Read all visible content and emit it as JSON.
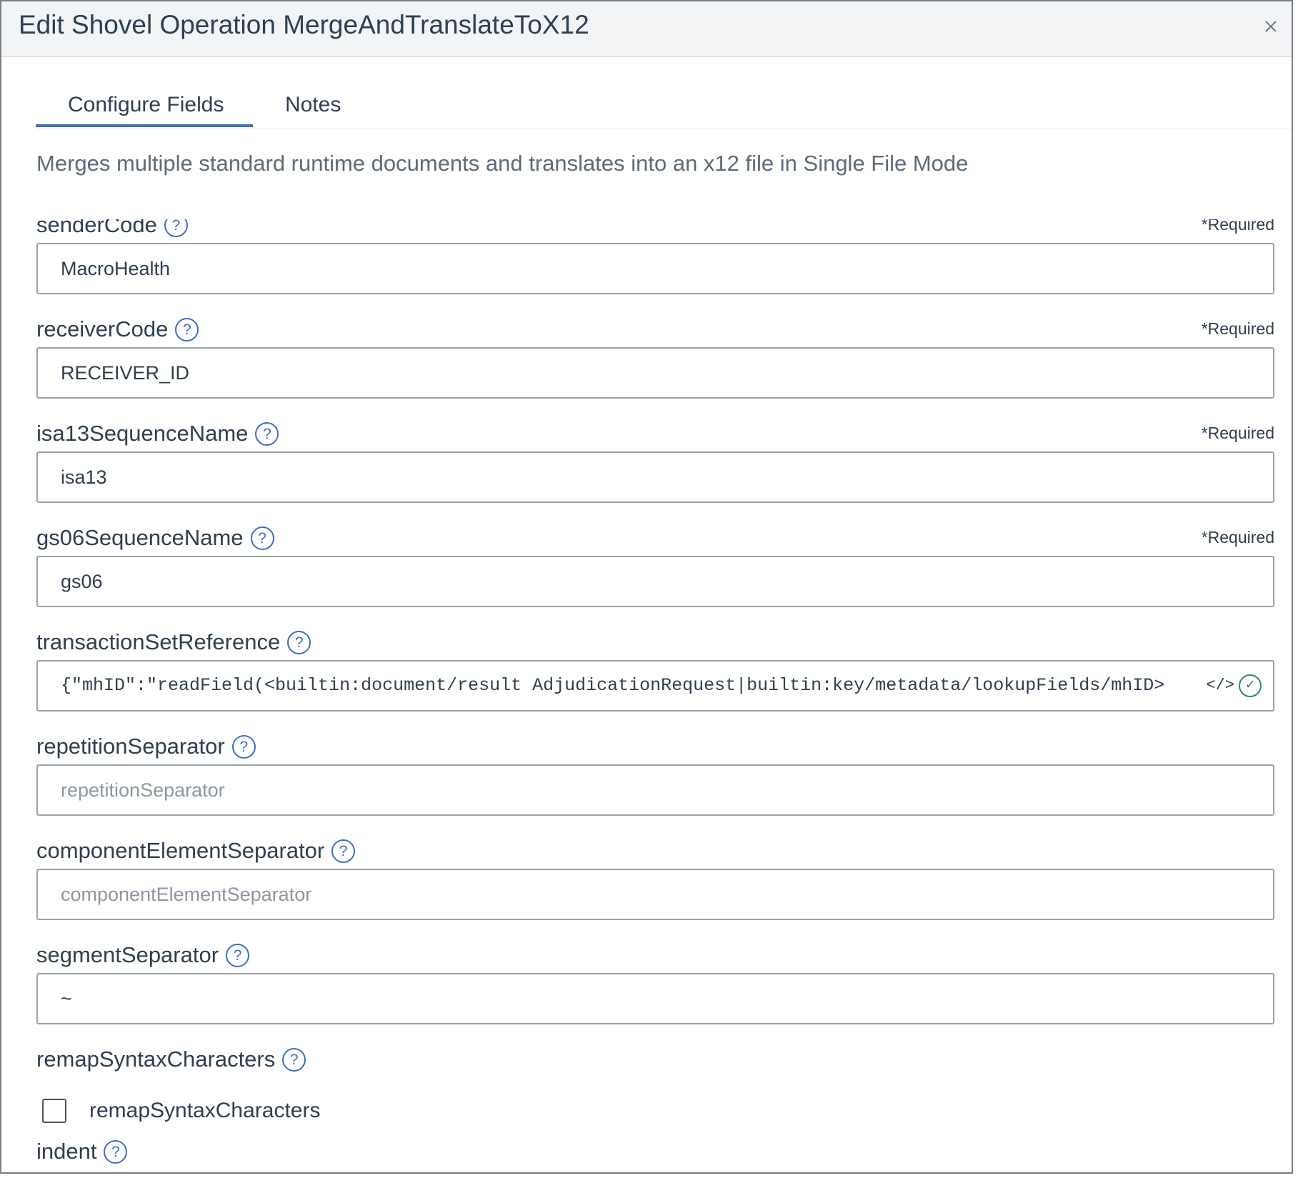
{
  "dialog": {
    "title": "Edit Shovel Operation MergeAndTranslateToX12",
    "close_glyph": "×"
  },
  "tabs": [
    {
      "label": "Configure Fields",
      "active": true
    },
    {
      "label": "Notes",
      "active": false
    }
  ],
  "description": "Merges multiple standard runtime documents and translates into an x12 file in Single File Mode",
  "help_glyph": "?",
  "required_label": "*Required",
  "fields": {
    "senderCode": {
      "label": "senderCode",
      "value": "MacroHealth",
      "required": true
    },
    "receiverCode": {
      "label": "receiverCode",
      "value": "RECEIVER_ID",
      "required": true
    },
    "isa13SequenceName": {
      "label": "isa13SequenceName",
      "value": "isa13",
      "required": true
    },
    "gs06SequenceName": {
      "label": "gs06SequenceName",
      "value": "gs06",
      "required": true
    },
    "transactionSetReference": {
      "label": "transactionSetReference",
      "value": "{\"mhID\":\"readField(<builtin:document/result AdjudicationRequest|builtin:key/metadata/lookupFields/mhID>",
      "code_icon": "</>",
      "valid_glyph": "✓"
    },
    "repetitionSeparator": {
      "label": "repetitionSeparator",
      "placeholder": "repetitionSeparator"
    },
    "componentElementSeparator": {
      "label": "componentElementSeparator",
      "placeholder": "componentElementSeparator"
    },
    "segmentSeparator": {
      "label": "segmentSeparator",
      "value": "~"
    },
    "remapSyntaxCharacters": {
      "label": "remapSyntaxCharacters",
      "checkbox_label": "remapSyntaxCharacters",
      "checked": false
    },
    "indent": {
      "label": "indent"
    }
  },
  "colors": {
    "accent": "#3a6fc4",
    "text": "#2e3f51",
    "valid": "#2e8b57",
    "header_bg": "#f3f4f6"
  }
}
